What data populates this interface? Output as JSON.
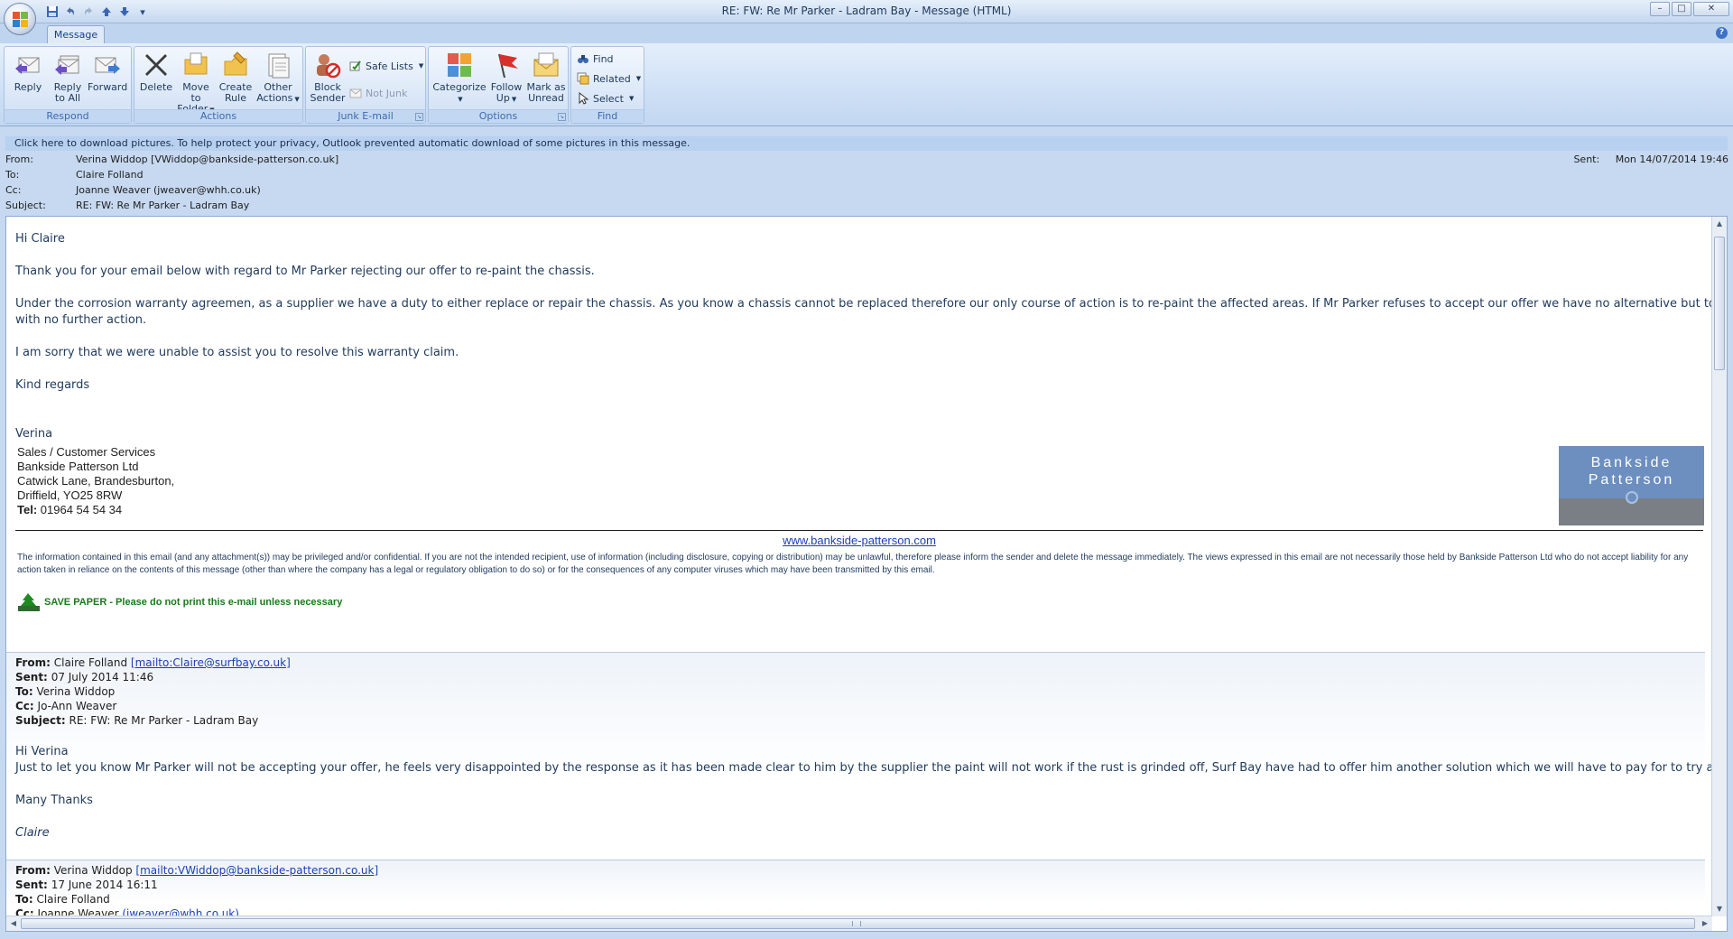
{
  "window": {
    "title": "RE: FW: Re Mr Parker - Ladram Bay - Message (HTML)",
    "minimize": "–",
    "maximize": "□",
    "close": "✕"
  },
  "quick_access": {
    "save_icon": "save-icon",
    "undo_icon": "undo-icon",
    "redo_icon": "redo-icon",
    "up_icon": "previous-item-icon",
    "down_icon": "next-item-icon",
    "more": "▾"
  },
  "ribbon": {
    "tabs": [
      {
        "label": "Message"
      }
    ],
    "help": "?",
    "groups": {
      "respond": {
        "label": "Respond",
        "reply": "Reply",
        "reply_all_1": "Reply",
        "reply_all_2": "to All",
        "forward": "Forward"
      },
      "actions": {
        "label": "Actions",
        "delete": "Delete",
        "move_1": "Move to",
        "move_2": "Folder",
        "create_1": "Create",
        "create_2": "Rule",
        "other_1": "Other",
        "other_2": "Actions"
      },
      "junk": {
        "label": "Junk E-mail",
        "block_1": "Block",
        "block_2": "Sender",
        "safe_lists": "Safe Lists",
        "not_junk": "Not Junk"
      },
      "options": {
        "label": "Options",
        "categorize": "Categorize",
        "follow_1": "Follow",
        "follow_2": "Up",
        "mark_1": "Mark as",
        "mark_2": "Unread"
      },
      "find": {
        "label": "Find",
        "find": "Find",
        "related": "Related",
        "select": "Select"
      }
    }
  },
  "infobar": "Click here to download pictures. To help protect your privacy, Outlook prevented automatic download of some pictures in this message.",
  "header": {
    "from_label": "From:",
    "from": "Verina Widdop [VWiddop@bankside-patterson.co.uk]",
    "to_label": "To:",
    "to": "Claire Folland",
    "cc_label": "Cc:",
    "cc": "Joanne Weaver (jweaver@whh.co.uk)",
    "subject_label": "Subject:",
    "subject": "RE: FW: Re Mr Parker - Ladram Bay",
    "sent_label": "Sent:",
    "sent": "Mon 14/07/2014 19:46"
  },
  "body": {
    "greeting": "Hi Claire",
    "p1": "Thank you for your email below with regard to Mr Parker rejecting our offer to re-paint the chassis.",
    "p2a": "Under the corrosion warranty agreemen, as a supplier we have a duty to either replace or repair the chassis.  As you know a chassis cannot be replaced therefore our only course of action is to re-paint the affected areas.  If Mr Parker refuses to accept our offer we have no alternative but to close this referral",
    "p2b": "with no further action.",
    "p3": "I am sorry that we were unable to assist you to resolve this warranty claim.",
    "closing": "Kind regards",
    "name": "Verina",
    "signature": {
      "dept": "Sales / Customer Services",
      "company": "Bankside Patterson Ltd",
      "addr1": "Catwick Lane, Brandesburton,",
      "addr2": "Driffield, YO25 8RW",
      "tel_label": "Tel:",
      "tel": " 01964 54 54 34",
      "logo_line1": "Bankside",
      "logo_line2": "Patterson"
    },
    "website": "www.bankside-patterson.com",
    "disclaimer": "The information contained in this email (and any attachment(s)) may be privileged and/or confidential. If you are not the intended recipient, use of information (including disclosure, copying or distribution) may be unlawful, therefore please inform the sender and delete the message immediately. The views expressed in this email are not necessarily those held by Bankside Patterson Ltd who do not accept liability for any action taken in reliance on the contents of this message (other than where the company has a legal or regulatory obligation to do so) or for the consequences of any computer viruses which may have been transmitted by this email.",
    "save_paper": "SAVE PAPER - Please do not print this e-mail unless necessary"
  },
  "quote1": {
    "from_label": "From:",
    "from_name": "Claire Folland ",
    "from_link": "[mailto:Claire@surfbay.co.uk]",
    "sent_label": "Sent:",
    "sent": "07 July 2014 11:46",
    "to_label": "To:",
    "to": "Verina Widdop",
    "cc_label": "Cc:",
    "cc": "Jo-Ann Weaver",
    "subject_label": "Subject:",
    "subject": "RE: FW: Re Mr Parker - Ladram Bay",
    "greeting": "Hi Verina",
    "text": "Just to let you know Mr Parker will not be accepting your offer, he feels very disappointed by the response as it has been made clear to him by the supplier the paint will not work if the rust is grinded off, Surf Bay have had to offer him another solution which we will have to pay for to try and help him",
    "thanks": "Many Thanks",
    "sign": "Claire"
  },
  "quote2": {
    "from_label": "From:",
    "from_name": "Verina Widdop ",
    "from_link": "[mailto:VWiddop@bankside-patterson.co.uk]",
    "sent_label": "Sent:",
    "sent": "17 June 2014 16:11",
    "to_label": "To:",
    "to": "Claire Folland",
    "cc_label": "Cc:",
    "cc_name": "Joanne Weaver ",
    "cc_link": "(jweaver@whh.co.uk)"
  },
  "colors": {
    "ribbon": "#cfe0f5",
    "link": "#1a3fb5",
    "body_text": "#1f3a5c",
    "save_paper": "#1a7a1a",
    "logo_blue": "#6d8fbf"
  }
}
